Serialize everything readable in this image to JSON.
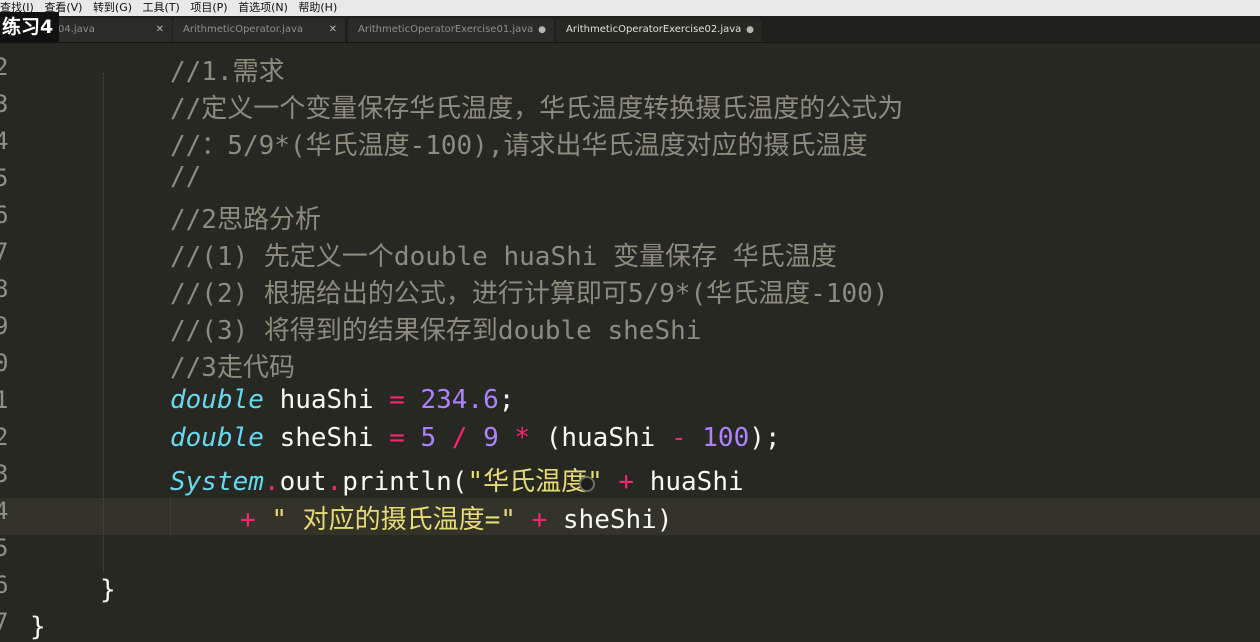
{
  "menu": [
    "查找(I)",
    "查看(V)",
    "转到(G)",
    "工具(T)",
    "项目(P)",
    "首选项(N)",
    "帮助(H)"
  ],
  "overlay_title": "练习4",
  "tabs": [
    {
      "label": "04.java",
      "state": "close"
    },
    {
      "label": "ArithmeticOperator.java",
      "state": "close"
    },
    {
      "label": "ArithmeticOperatorExercise01.java",
      "state": "modified"
    },
    {
      "label": "ArithmeticOperatorExercise02.java",
      "state": "modified",
      "active": true
    }
  ],
  "gutter": [
    "2",
    "3",
    "4",
    "5",
    "6",
    "7",
    "8",
    "9",
    "0",
    "1",
    "2",
    "3",
    "4",
    "5",
    "6",
    "7"
  ],
  "code": {
    "l1": "//1.需求",
    "l2": "//定义一个变量保存华氏温度，华氏温度转换摄氏温度的公式为",
    "l3": "//：5/9*(华氏温度-100),请求出华氏温度对应的摄氏温度",
    "l4": "//",
    "l5": "//2思路分析",
    "l6": "//(1) 先定义一个double huaShi 变量保存 华氏温度",
    "l7": "//(2) 根据给出的公式，进行计算即可5/9*(华氏温度-100)",
    "l8": "//(3) 将得到的结果保存到double sheShi",
    "l9": "//3走代码",
    "kw_double": "double",
    "var_huashi": "huaShi",
    "var_sheshi": "sheShi",
    "op_assign": "=",
    "val_huashi": "234.6",
    "semi": ";",
    "num5": "5",
    "op_div": "/",
    "num9": "9",
    "op_mul": "*",
    "open_paren": "(",
    "op_minus": "-",
    "num100": "100",
    "close_semi": ");",
    "system": "System",
    "dot": ".",
    "out": "out",
    "println": "println(",
    "str1": "\"华氏温度\"",
    "op_plus": "+",
    "str2": "\" 对应的摄氏温度=\"",
    "close_paren": ")",
    "brace": "}"
  },
  "colors": {
    "background": "#272822",
    "comment": "#8d8b7e",
    "keyword": "#66d9ef",
    "number": "#ae81ff",
    "operator": "#f92672",
    "string": "#e6db74",
    "text": "#f8f8f2"
  }
}
